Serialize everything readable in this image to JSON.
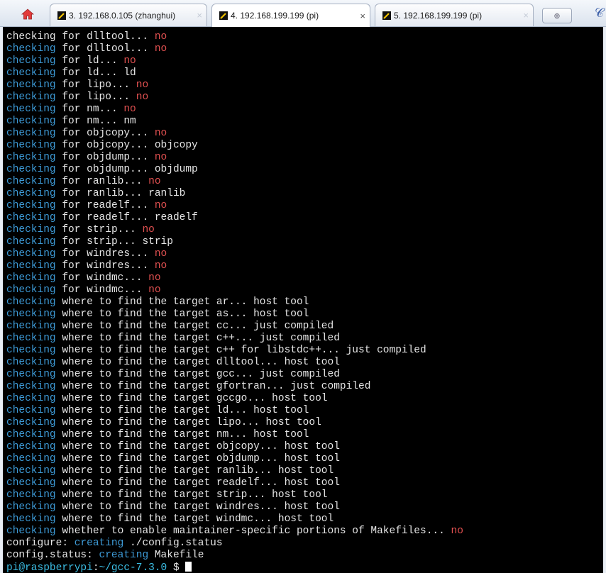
{
  "tabs": [
    {
      "label": "3. 192.168.0.105 (zhanghui)",
      "active": false
    },
    {
      "label": "4. 192.168.199.199 (pi)",
      "active": true
    },
    {
      "label": "5. 192.168.199.199 (pi)",
      "active": false
    }
  ],
  "tab_close_glyph": "×",
  "colors": {
    "keyword": "#3d9ad6",
    "no": "#e05050",
    "prompt": "#3cbfe6",
    "background": "#000000"
  },
  "terminal": {
    "lines": [
      [
        [
          "checking for dlltool... ",
          ""
        ],
        [
          "no",
          "no"
        ]
      ],
      [
        [
          "checking",
          "kw"
        ],
        [
          " for dlltool... ",
          ""
        ],
        [
          "no",
          "no"
        ]
      ],
      [
        [
          "checking",
          "kw"
        ],
        [
          " for ld... ",
          ""
        ],
        [
          "no",
          "no"
        ]
      ],
      [
        [
          "checking",
          "kw"
        ],
        [
          " for ld... ld",
          ""
        ]
      ],
      [
        [
          "checking",
          "kw"
        ],
        [
          " for lipo... ",
          ""
        ],
        [
          "no",
          "no"
        ]
      ],
      [
        [
          "checking",
          "kw"
        ],
        [
          " for lipo... ",
          ""
        ],
        [
          "no",
          "no"
        ]
      ],
      [
        [
          "checking",
          "kw"
        ],
        [
          " for nm... ",
          ""
        ],
        [
          "no",
          "no"
        ]
      ],
      [
        [
          "checking",
          "kw"
        ],
        [
          " for nm... nm",
          ""
        ]
      ],
      [
        [
          "checking",
          "kw"
        ],
        [
          " for objcopy... ",
          ""
        ],
        [
          "no",
          "no"
        ]
      ],
      [
        [
          "checking",
          "kw"
        ],
        [
          " for objcopy... objcopy",
          ""
        ]
      ],
      [
        [
          "checking",
          "kw"
        ],
        [
          " for objdump... ",
          ""
        ],
        [
          "no",
          "no"
        ]
      ],
      [
        [
          "checking",
          "kw"
        ],
        [
          " for objdump... objdump",
          ""
        ]
      ],
      [
        [
          "checking",
          "kw"
        ],
        [
          " for ranlib... ",
          ""
        ],
        [
          "no",
          "no"
        ]
      ],
      [
        [
          "checking",
          "kw"
        ],
        [
          " for ranlib... ranlib",
          ""
        ]
      ],
      [
        [
          "checking",
          "kw"
        ],
        [
          " for readelf... ",
          ""
        ],
        [
          "no",
          "no"
        ]
      ],
      [
        [
          "checking",
          "kw"
        ],
        [
          " for readelf... readelf",
          ""
        ]
      ],
      [
        [
          "checking",
          "kw"
        ],
        [
          " for strip... ",
          ""
        ],
        [
          "no",
          "no"
        ]
      ],
      [
        [
          "checking",
          "kw"
        ],
        [
          " for strip... strip",
          ""
        ]
      ],
      [
        [
          "checking",
          "kw"
        ],
        [
          " for windres... ",
          ""
        ],
        [
          "no",
          "no"
        ]
      ],
      [
        [
          "checking",
          "kw"
        ],
        [
          " for windres... ",
          ""
        ],
        [
          "no",
          "no"
        ]
      ],
      [
        [
          "checking",
          "kw"
        ],
        [
          " for windmc... ",
          ""
        ],
        [
          "no",
          "no"
        ]
      ],
      [
        [
          "checking",
          "kw"
        ],
        [
          " for windmc... ",
          ""
        ],
        [
          "no",
          "no"
        ]
      ],
      [
        [
          "checking",
          "kw"
        ],
        [
          " where to find the target ar... host tool",
          ""
        ]
      ],
      [
        [
          "checking",
          "kw"
        ],
        [
          " where to find the target as... host tool",
          ""
        ]
      ],
      [
        [
          "checking",
          "kw"
        ],
        [
          " where to find the target cc... just compiled",
          ""
        ]
      ],
      [
        [
          "checking",
          "kw"
        ],
        [
          " where to find the target c++... just compiled",
          ""
        ]
      ],
      [
        [
          "checking",
          "kw"
        ],
        [
          " where to find the target c++ for libstdc++... just compiled",
          ""
        ]
      ],
      [
        [
          "checking",
          "kw"
        ],
        [
          " where to find the target dlltool... host tool",
          ""
        ]
      ],
      [
        [
          "checking",
          "kw"
        ],
        [
          " where to find the target gcc... just compiled",
          ""
        ]
      ],
      [
        [
          "checking",
          "kw"
        ],
        [
          " where to find the target gfortran... just compiled",
          ""
        ]
      ],
      [
        [
          "checking",
          "kw"
        ],
        [
          " where to find the target gccgo... host tool",
          ""
        ]
      ],
      [
        [
          "checking",
          "kw"
        ],
        [
          " where to find the target ld... host tool",
          ""
        ]
      ],
      [
        [
          "checking",
          "kw"
        ],
        [
          " where to find the target lipo... host tool",
          ""
        ]
      ],
      [
        [
          "checking",
          "kw"
        ],
        [
          " where to find the target nm... host tool",
          ""
        ]
      ],
      [
        [
          "checking",
          "kw"
        ],
        [
          " where to find the target objcopy... host tool",
          ""
        ]
      ],
      [
        [
          "checking",
          "kw"
        ],
        [
          " where to find the target objdump... host tool",
          ""
        ]
      ],
      [
        [
          "checking",
          "kw"
        ],
        [
          " where to find the target ranlib... host tool",
          ""
        ]
      ],
      [
        [
          "checking",
          "kw"
        ],
        [
          " where to find the target readelf... host tool",
          ""
        ]
      ],
      [
        [
          "checking",
          "kw"
        ],
        [
          " where to find the target strip... host tool",
          ""
        ]
      ],
      [
        [
          "checking",
          "kw"
        ],
        [
          " where to find the target windres... host tool",
          ""
        ]
      ],
      [
        [
          "checking",
          "kw"
        ],
        [
          " where to find the target windmc... host tool",
          ""
        ]
      ],
      [
        [
          "checking",
          "kw"
        ],
        [
          " whether to enable maintainer-specific portions of Makefiles... ",
          ""
        ],
        [
          "no",
          "no"
        ]
      ],
      [
        [
          "configure: ",
          ""
        ],
        [
          "creating",
          "kw"
        ],
        [
          " ./config.status",
          ""
        ]
      ],
      [
        [
          "config.status: ",
          ""
        ],
        [
          "creating",
          "kw"
        ],
        [
          " Makefile",
          ""
        ]
      ]
    ],
    "prompt": {
      "user_host": "pi@raspberrypi",
      "sep": ":",
      "path": "~/gcc-7.3.0",
      "symbol": " $ "
    }
  }
}
